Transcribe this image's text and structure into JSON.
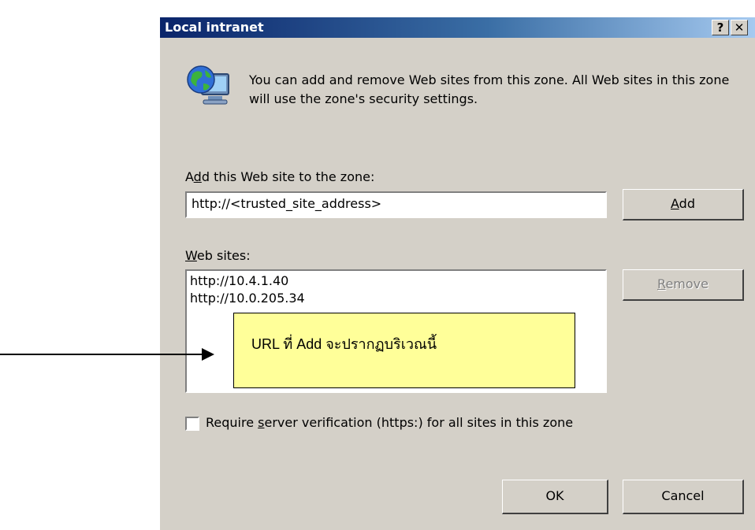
{
  "dialog": {
    "title": "Local intranet",
    "help_label": "?",
    "close_label": "✕",
    "intro_text": "You can add and remove Web sites from this zone. All Web sites in this zone will use the zone's security settings."
  },
  "add_section": {
    "label_pre": "A",
    "label_ul": "d",
    "label_post": "d this Web site to the zone:",
    "input_value": "http://<trusted_site_address>",
    "add_button_ul": "A",
    "add_button_post": "dd"
  },
  "sites_section": {
    "label_ul": "W",
    "label_post": "eb sites:",
    "sites": [
      "http://10.4.1.40",
      "http://10.0.205.34"
    ],
    "remove_button_ul": "R",
    "remove_button_post": "emove"
  },
  "verification": {
    "label_pre": "Require ",
    "label_ul": "s",
    "label_post": "erver verification (https:) for all sites in this zone",
    "checked": false
  },
  "buttons": {
    "ok": "OK",
    "cancel": "Cancel"
  },
  "annotation": {
    "callout_text": "URL ที่ Add จะปรากฏบริเวณนี้",
    "callout_color": "#ffff99"
  },
  "icons": {
    "zone": "globe-monitor-icon",
    "arrow": "arrow-right-icon"
  },
  "colors": {
    "titlebar_start": "#0a246a",
    "titlebar_end": "#a6caf0",
    "dialog_bg": "#d4d0c8"
  }
}
